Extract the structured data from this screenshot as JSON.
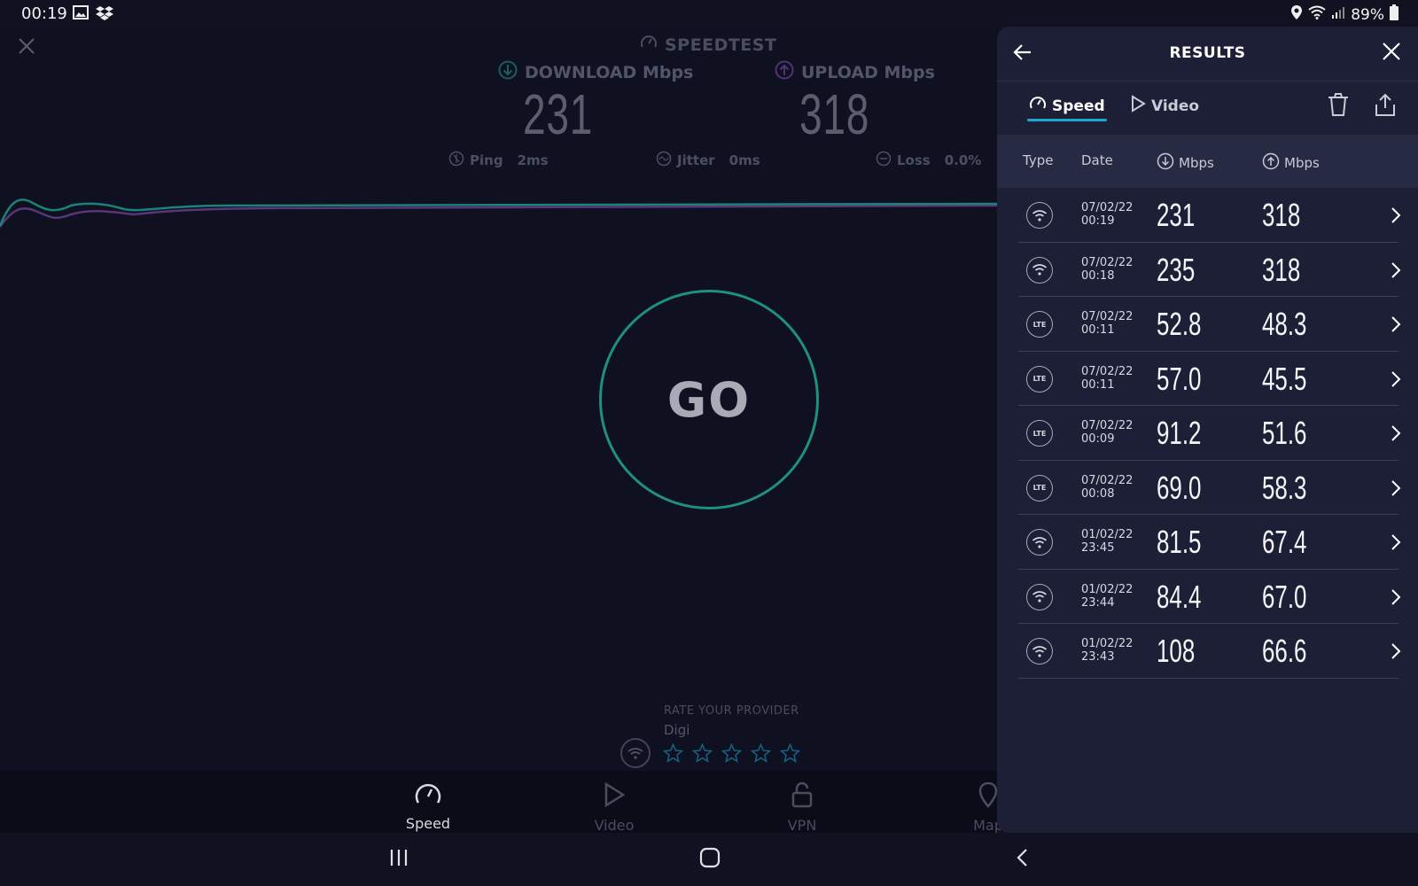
{
  "status_bar": {
    "time": "00:19",
    "battery": "89%"
  },
  "main": {
    "brand": "SPEEDTEST",
    "download_label": "DOWNLOAD Mbps",
    "upload_label": "UPLOAD Mbps",
    "download_value": "231",
    "upload_value": "318",
    "ping_label": "Ping",
    "ping_value": "2ms",
    "jitter_label": "Jitter",
    "jitter_value": "0ms",
    "loss_label": "Loss",
    "loss_value": "0.0%",
    "go_label": "GO",
    "rate_title": "RATE YOUR PROVIDER",
    "provider": "Digi"
  },
  "bottom_nav": {
    "speed": "Speed",
    "video": "Video",
    "vpn": "VPN",
    "map": "Map"
  },
  "results": {
    "title": "RESULTS",
    "tabs": {
      "speed": "Speed",
      "video": "Video"
    },
    "columns": {
      "type": "Type",
      "date": "Date",
      "download": "Mbps",
      "upload": "Mbps"
    },
    "rows": [
      {
        "type": "wifi",
        "date": "07/02/22",
        "time": "00:19",
        "down": "231",
        "up": "318"
      },
      {
        "type": "wifi",
        "date": "07/02/22",
        "time": "00:18",
        "down": "235",
        "up": "318"
      },
      {
        "type": "lte",
        "date": "07/02/22",
        "time": "00:11",
        "down": "52.8",
        "up": "48.3"
      },
      {
        "type": "lte",
        "date": "07/02/22",
        "time": "00:11",
        "down": "57.0",
        "up": "45.5"
      },
      {
        "type": "lte",
        "date": "07/02/22",
        "time": "00:09",
        "down": "91.2",
        "up": "51.6"
      },
      {
        "type": "lte",
        "date": "07/02/22",
        "time": "00:08",
        "down": "69.0",
        "up": "58.3"
      },
      {
        "type": "wifi",
        "date": "01/02/22",
        "time": "23:45",
        "down": "81.5",
        "up": "67.4"
      },
      {
        "type": "wifi",
        "date": "01/02/22",
        "time": "23:44",
        "down": "84.4",
        "up": "67.0"
      },
      {
        "type": "wifi",
        "date": "01/02/22",
        "time": "23:43",
        "down": "108",
        "up": "66.6"
      }
    ],
    "lte_label": "LTE"
  },
  "colors": {
    "accent": "#1aa5d6",
    "download": "#1fa38f",
    "upload": "#8e4fb6",
    "panel_bg": "#1c1f35"
  }
}
